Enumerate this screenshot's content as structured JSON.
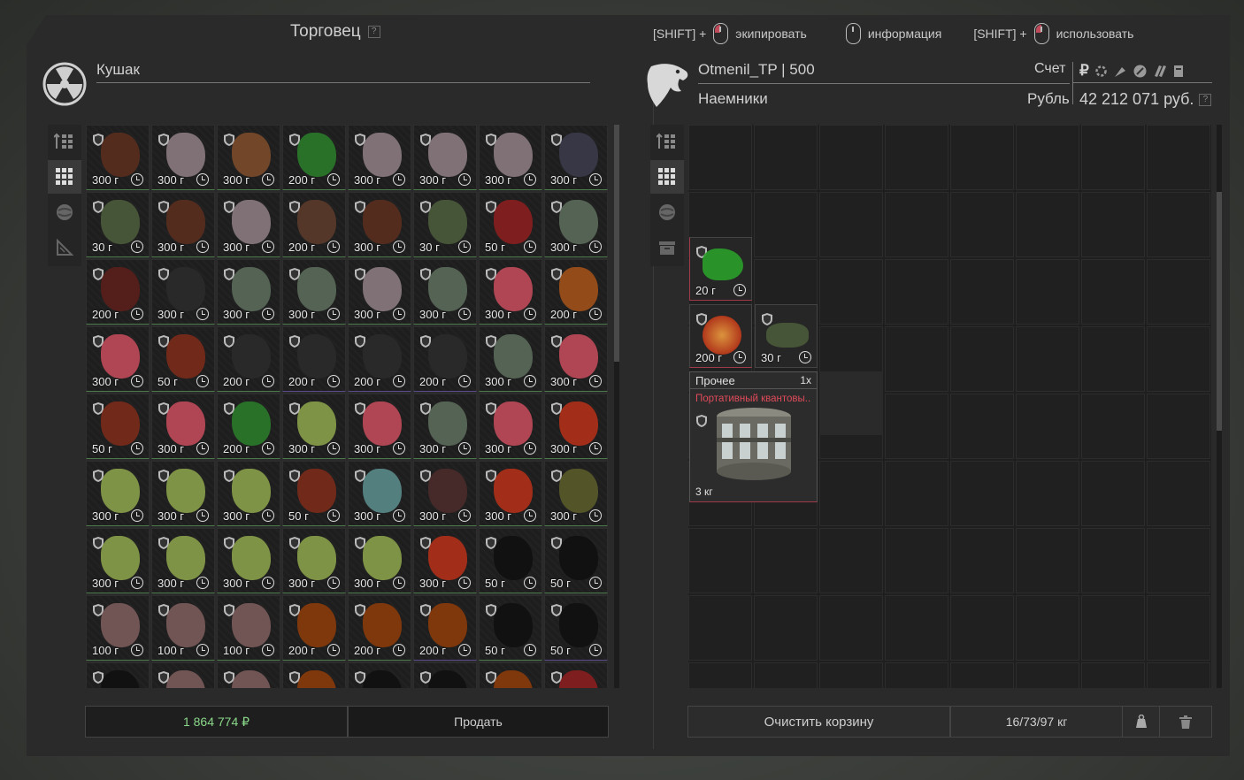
{
  "trader_panel": {
    "title": "Торговец",
    "help": "?",
    "trader_name": "Кушак",
    "total": "1 864 774 ₽",
    "sell_button": "Продать"
  },
  "hints": [
    {
      "prefix": "[SHIFT] +",
      "label": "экипировать",
      "mouse": "left"
    },
    {
      "prefix": "",
      "label": "информация",
      "mouse": "none"
    },
    {
      "prefix": "[SHIFT] +",
      "label": "использовать",
      "mouse": "right"
    }
  ],
  "player_panel": {
    "name": "Otmenil_TP | 500",
    "faction": "Наемники",
    "account_label": "Счет",
    "currency_label": "Рубль",
    "currency_symbol": "₽",
    "balance": "42 212 071 руб.",
    "help": "?",
    "clear_button": "Очистить корзину",
    "weight": "16/73/97 кг"
  },
  "cart_items": [
    {
      "price": "20 г",
      "color": "#2aa02a"
    },
    {
      "price": "200 г",
      "color": "#e0502a"
    },
    {
      "price": "30 г",
      "color": "#4a5a3a"
    }
  ],
  "cart_big_item": {
    "category": "Прочее",
    "qty": "1x",
    "name": "Портативный квантовы..",
    "weight": "3 кг"
  },
  "trader_items": [
    {
      "price": "300 г",
      "color": "#5a2e1e",
      "b": "g"
    },
    {
      "price": "300 г",
      "color": "#8a7a80",
      "b": "g"
    },
    {
      "price": "300 г",
      "color": "#7a4a2a",
      "b": "g"
    },
    {
      "price": "200 г",
      "color": "#2a7a2a",
      "b": "g"
    },
    {
      "price": "300 г",
      "color": "#8a7a80",
      "b": "g"
    },
    {
      "price": "300 г",
      "color": "#8a7a80",
      "b": "g"
    },
    {
      "price": "300 г",
      "color": "#8a7a80",
      "b": "g"
    },
    {
      "price": "300 г",
      "color": "#3a3a4a",
      "b": "g"
    },
    {
      "price": "30 г",
      "color": "#4a5a3a",
      "b": "g"
    },
    {
      "price": "300 г",
      "color": "#5a2e1e",
      "b": "g"
    },
    {
      "price": "300 г",
      "color": "#8a7a80",
      "b": "g"
    },
    {
      "price": "200 г",
      "color": "#5a3a2a",
      "b": "g"
    },
    {
      "price": "300 г",
      "color": "#5a2e1e",
      "b": "g"
    },
    {
      "price": "30 г",
      "color": "#4a5a3a",
      "b": "g"
    },
    {
      "price": "50 г",
      "color": "#8a1e1e",
      "b": "g"
    },
    {
      "price": "300 г",
      "color": "#5a6a5a",
      "b": "g"
    },
    {
      "price": "200 г",
      "color": "#5a1e1a",
      "b": "g"
    },
    {
      "price": "300 г",
      "color": "#2a2a2a",
      "b": "g"
    },
    {
      "price": "300 г",
      "color": "#5a6a5a",
      "b": "g"
    },
    {
      "price": "300 г",
      "color": "#5a6a5a",
      "b": "g"
    },
    {
      "price": "300 г",
      "color": "#8a7a80",
      "b": "g"
    },
    {
      "price": "300 г",
      "color": "#5a6a5a",
      "b": "g"
    },
    {
      "price": "300 г",
      "color": "#c04a5a",
      "b": "g"
    },
    {
      "price": "200 г",
      "color": "#a0501a",
      "b": "g"
    },
    {
      "price": "300 г",
      "color": "#c04a5a",
      "b": "g"
    },
    {
      "price": "50 г",
      "color": "#7a2a1a",
      "b": "g"
    },
    {
      "price": "200 г",
      "color": "#2a2a2a",
      "b": "g"
    },
    {
      "price": "200 г",
      "color": "#2a2a2a",
      "b": "p"
    },
    {
      "price": "200 г",
      "color": "#2a2a2a",
      "b": "p"
    },
    {
      "price": "200 г",
      "color": "#2a2a2a",
      "b": "p"
    },
    {
      "price": "300 г",
      "color": "#5a6a5a",
      "b": "g"
    },
    {
      "price": "300 г",
      "color": "#c04a5a",
      "b": "g"
    },
    {
      "price": "50 г",
      "color": "#7a2a1a",
      "b": "g"
    },
    {
      "price": "300 г",
      "color": "#c04a5a",
      "b": "g"
    },
    {
      "price": "200 г",
      "color": "#2a7a2a",
      "b": "g"
    },
    {
      "price": "300 г",
      "color": "#8aa04a",
      "b": "g"
    },
    {
      "price": "300 г",
      "color": "#c04a5a",
      "b": "g"
    },
    {
      "price": "300 г",
      "color": "#5a6a5a",
      "b": "g"
    },
    {
      "price": "300 г",
      "color": "#c04a5a",
      "b": "g"
    },
    {
      "price": "300 г",
      "color": "#b0301a",
      "b": "g"
    },
    {
      "price": "300 г",
      "color": "#8aa04a",
      "b": "g"
    },
    {
      "price": "300 г",
      "color": "#8aa04a",
      "b": "g"
    },
    {
      "price": "300 г",
      "color": "#8aa04a",
      "b": "g"
    },
    {
      "price": "50 г",
      "color": "#7a2a1a",
      "b": "g"
    },
    {
      "price": "300 г",
      "color": "#5a8a8a",
      "b": "g"
    },
    {
      "price": "300 г",
      "color": "#4a2a2a",
      "b": "g"
    },
    {
      "price": "300 г",
      "color": "#b0301a",
      "b": "g"
    },
    {
      "price": "300 г",
      "color": "#5a5a2a",
      "b": "g"
    },
    {
      "price": "300 г",
      "color": "#8aa04a",
      "b": "g"
    },
    {
      "price": "300 г",
      "color": "#8aa04a",
      "b": "g"
    },
    {
      "price": "300 г",
      "color": "#8aa04a",
      "b": "g"
    },
    {
      "price": "300 г",
      "color": "#8aa04a",
      "b": "g"
    },
    {
      "price": "300 г",
      "color": "#8aa04a",
      "b": "g"
    },
    {
      "price": "300 г",
      "color": "#b0301a",
      "b": "g"
    },
    {
      "price": "50 г",
      "color": "#101010",
      "b": "g"
    },
    {
      "price": "50 г",
      "color": "#101010",
      "b": "g"
    },
    {
      "price": "100 г",
      "color": "#7a5a5a",
      "b": "g"
    },
    {
      "price": "100 г",
      "color": "#7a5a5a",
      "b": "g"
    },
    {
      "price": "100 г",
      "color": "#7a5a5a",
      "b": "g"
    },
    {
      "price": "200 г",
      "color": "#8a3a0a",
      "b": "g"
    },
    {
      "price": "200 г",
      "color": "#8a3a0a",
      "b": "g"
    },
    {
      "price": "200 г",
      "color": "#8a3a0a",
      "b": "p"
    },
    {
      "price": "50 г",
      "color": "#101010",
      "b": "g"
    },
    {
      "price": "50 г",
      "color": "#101010",
      "b": "p"
    },
    {
      "price": "",
      "color": "#101010",
      "b": "p"
    },
    {
      "price": "",
      "color": "#7a5a5a",
      "b": "g"
    },
    {
      "price": "",
      "color": "#7a5a5a",
      "b": "g"
    },
    {
      "price": "",
      "color": "#8a3a0a",
      "b": "g"
    },
    {
      "price": "",
      "color": "#101010",
      "b": "g"
    },
    {
      "price": "",
      "color": "#101010",
      "b": "g"
    },
    {
      "price": "",
      "color": "#8a3a0a",
      "b": "g"
    },
    {
      "price": "",
      "color": "#8a1e1e",
      "b": "g"
    }
  ]
}
